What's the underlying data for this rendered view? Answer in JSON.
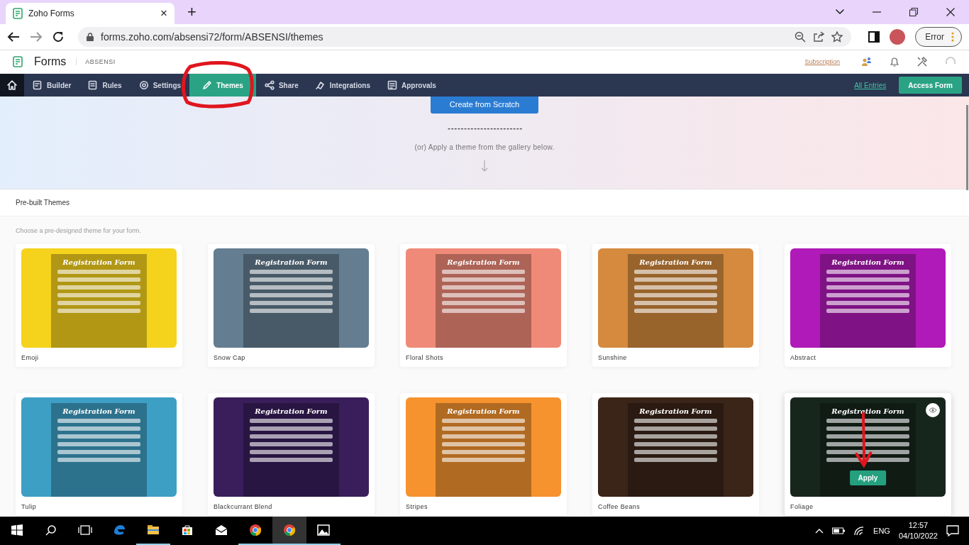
{
  "browser": {
    "tab_title": "Zoho Forms",
    "tab_close": "×",
    "new_tab": "+",
    "url": "forms.zoho.com/absensi72/form/ABSENSI/themes",
    "profile_button": "Error"
  },
  "app_header": {
    "logo": "Forms",
    "form_name": "ABSENSI",
    "subscription_link": "Subscription"
  },
  "nav": {
    "items": [
      {
        "label": "Builder",
        "selected": false
      },
      {
        "label": "Rules",
        "selected": false
      },
      {
        "label": "Settings",
        "selected": false
      },
      {
        "label": "Themes",
        "selected": true
      },
      {
        "label": "Share",
        "selected": false
      },
      {
        "label": "Integrations",
        "selected": false
      },
      {
        "label": "Approvals",
        "selected": false
      }
    ],
    "all_entries_link": "All Entries",
    "access_form_button": "Access Form"
  },
  "hero": {
    "create_button": "Create from Scratch",
    "divider": "-----------------------",
    "hint": "(or) Apply a theme from the gallery below."
  },
  "section": {
    "title": "Pre-built Themes",
    "description": "Choose a pre-designed theme for your form."
  },
  "themes": [
    {
      "name": "Emoji",
      "color": "#f5d21c",
      "preview_title": "Registration Form",
      "hovered": false
    },
    {
      "name": "Snow Cap",
      "color": "#647d90",
      "preview_title": "Registration Form",
      "hovered": false
    },
    {
      "name": "Floral Shots",
      "color": "#f08a78",
      "preview_title": "Registration Form",
      "hovered": false
    },
    {
      "name": "Sunshine",
      "color": "#d58a3e",
      "preview_title": "Registration Form",
      "hovered": false
    },
    {
      "name": "Abstract",
      "color": "#b01ab8",
      "preview_title": "Registration Form",
      "hovered": false
    },
    {
      "name": "Tulip",
      "color": "#3d9fc4",
      "preview_title": "Registration Form",
      "hovered": false
    },
    {
      "name": "Blackcurrant Blend",
      "color": "#3a1e5c",
      "preview_title": "Registration Form",
      "hovered": false
    },
    {
      "name": "Stripes",
      "color": "#f6932e",
      "preview_title": "Registration Form",
      "hovered": false
    },
    {
      "name": "Coffee Beans",
      "color": "#3b2418",
      "preview_title": "Registration Form",
      "hovered": false
    },
    {
      "name": "Foliage",
      "color": "#17261c",
      "preview_title": "Registration Form",
      "hovered": true,
      "apply_button": "Apply"
    }
  ],
  "taskbar": {
    "apps": [
      {
        "kind": "edge",
        "running": false,
        "selected": false
      },
      {
        "kind": "explorer",
        "running": true,
        "selected": false
      },
      {
        "kind": "store",
        "running": false,
        "selected": false
      },
      {
        "kind": "mail",
        "running": false,
        "selected": false
      },
      {
        "kind": "chrome",
        "running": true,
        "selected": false
      },
      {
        "kind": "chrome",
        "running": true,
        "selected": true
      },
      {
        "kind": "photos",
        "running": true,
        "selected": false
      }
    ],
    "language": "ENG",
    "time": "12:57",
    "date": "04/10/2022"
  }
}
